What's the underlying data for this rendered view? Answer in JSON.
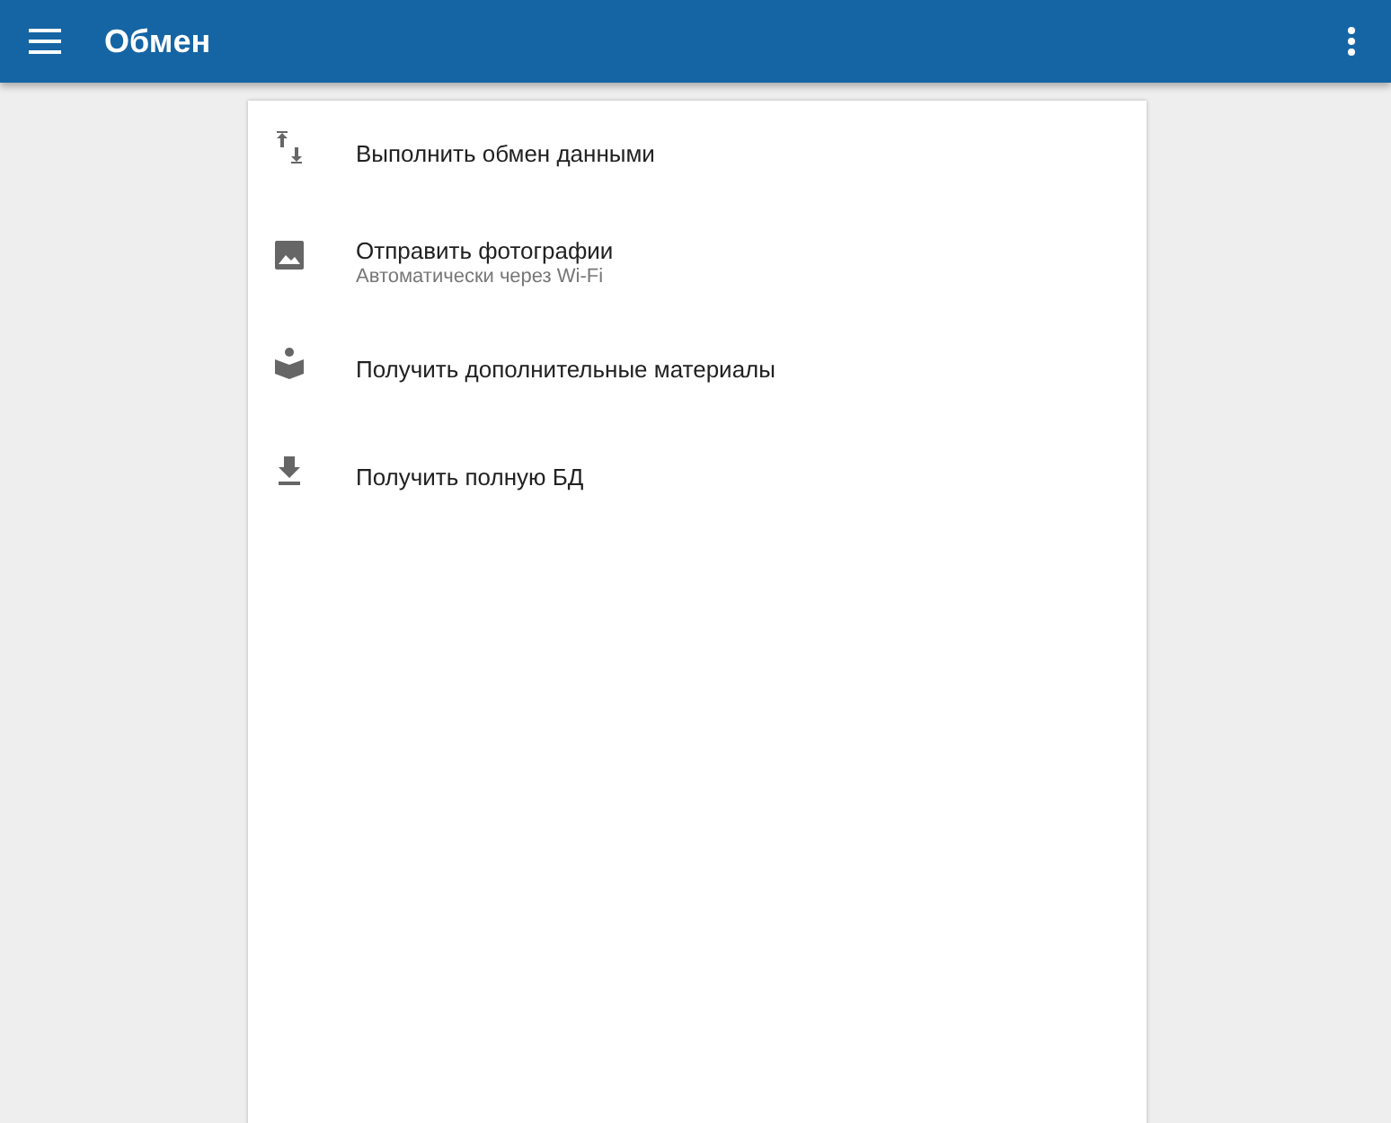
{
  "app_bar": {
    "title": "Обмен"
  },
  "items": [
    {
      "kind": "sync",
      "title": "Выполнить обмен данными"
    },
    {
      "kind": "photo",
      "title": "Отправить фотографии",
      "subtitle": "Автоматически через Wi-Fi"
    },
    {
      "kind": "book",
      "title": "Получить дополнительные материалы"
    },
    {
      "kind": "download",
      "title": "Получить полную БД"
    }
  ]
}
